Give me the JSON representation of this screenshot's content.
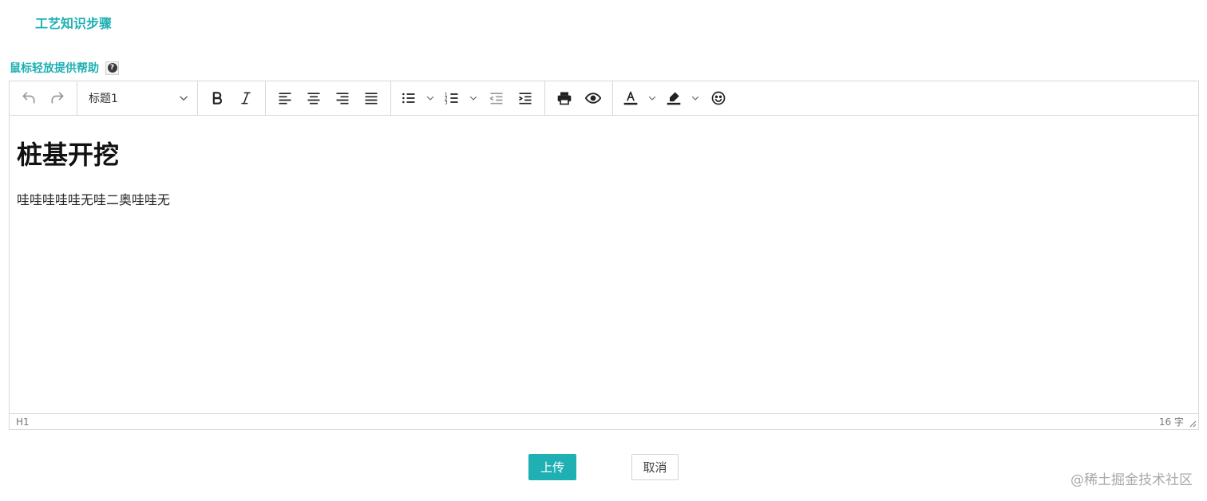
{
  "page": {
    "section_title": "工艺知识步骤",
    "help_label": "鼠标轻放提供帮助",
    "help_icon": "question-circle-icon"
  },
  "toolbar": {
    "heading_select": "标题1",
    "icons": [
      "undo-icon",
      "redo-icon",
      "bold-icon",
      "italic-icon",
      "align-left-icon",
      "align-center-icon",
      "align-right-icon",
      "align-justify-icon",
      "bullet-list-icon",
      "numbered-list-icon",
      "outdent-icon",
      "indent-icon",
      "print-icon",
      "preview-icon",
      "text-color-icon",
      "highlight-icon",
      "emoji-icon"
    ]
  },
  "editor": {
    "heading": "桩基开挖",
    "paragraph": "哇哇哇哇哇无哇二奥哇哇无"
  },
  "statusbar": {
    "path": "H1",
    "word_count": "16 字"
  },
  "actions": {
    "upload_label": "上传",
    "cancel_label": "取消"
  },
  "watermark": "@稀土掘金技术社区",
  "colors": {
    "accent": "#1fb0b3",
    "text_color_bar": "#222222"
  }
}
